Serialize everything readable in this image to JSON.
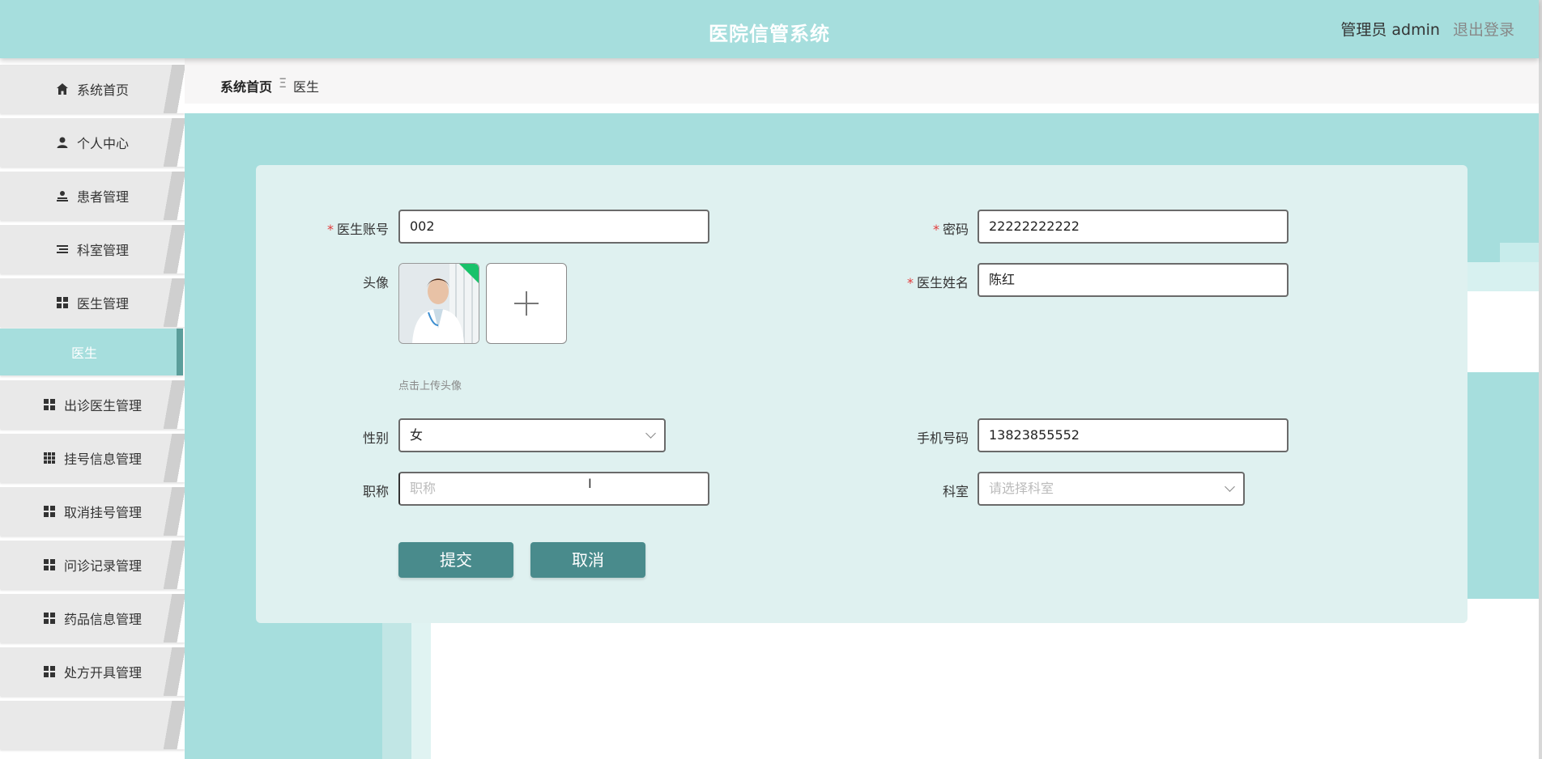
{
  "header": {
    "title": "医院信管系统",
    "user_role": "管理员 admin",
    "logout_label": "退出登录"
  },
  "sidebar": {
    "items": [
      {
        "label": "系统首页",
        "icon": "home-icon"
      },
      {
        "label": "个人中心",
        "icon": "user-icon"
      },
      {
        "label": "患者管理",
        "icon": "patient-icon"
      },
      {
        "label": "科室管理",
        "icon": "list-icon"
      },
      {
        "label": "医生管理",
        "icon": "grid-icon"
      },
      {
        "label": "医生",
        "icon": ""
      },
      {
        "label": "出诊医生管理",
        "icon": "grid-icon"
      },
      {
        "label": "挂号信息管理",
        "icon": "grid9-icon"
      },
      {
        "label": "取消挂号管理",
        "icon": "grid-icon"
      },
      {
        "label": "问诊记录管理",
        "icon": "grid-icon"
      },
      {
        "label": "药品信息管理",
        "icon": "grid-icon"
      },
      {
        "label": "处方开具管理",
        "icon": "grid-icon"
      }
    ]
  },
  "breadcrumb": {
    "home": "系统首页",
    "separator": "Ξ",
    "current": "医生"
  },
  "form": {
    "account_label": "医生账号",
    "account_value": "002",
    "password_label": "密码",
    "password_value": "22222222222",
    "avatar_label": "头像",
    "name_label": "医生姓名",
    "name_value": "陈红",
    "upload_hint": "点击上传头像",
    "upload_plus": "+",
    "gender_label": "性别",
    "gender_value": "女",
    "phone_label": "手机号码",
    "phone_value": "13823855552",
    "title_label": "职称",
    "title_placeholder": "职称",
    "dept_label": "科室",
    "dept_placeholder": "请选择科室",
    "submit_label": "提交",
    "cancel_label": "取消"
  },
  "colors": {
    "accent": "#a6dedd",
    "button": "#498b8c",
    "required": "#e23b3b"
  }
}
